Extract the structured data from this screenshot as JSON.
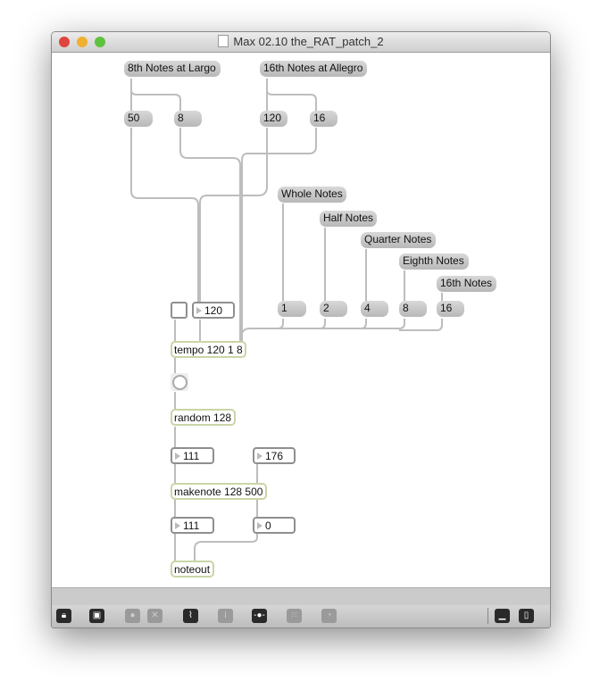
{
  "window": {
    "title": "Max 02.10 the_RAT_patch_2"
  },
  "patch": {
    "largo": "8th Notes at Largo",
    "allegro": "16th Notes at Allegro",
    "m50": "50",
    "m8a": "8",
    "m120": "120",
    "m16a": "16",
    "whole": "Whole Notes",
    "half": "Half Notes",
    "quarter": "Quarter Notes",
    "eighth": "Eighth Notes",
    "sixteenth": "16th Notes",
    "m1": "1",
    "m2": "2",
    "m4": "4",
    "m8b": "8",
    "m16b": "16",
    "tempo_num": "120",
    "tempo": "tempo 120 1 8",
    "random": "random 128",
    "pitch_num": "111",
    "dur_num": "176",
    "makenote": "makenote 128 500",
    "out_pitch": "111",
    "out_vel": "0",
    "noteout": "noteout"
  },
  "toolbar": {
    "icons": [
      "lock-icon",
      "presentation-toggle-icon",
      "objects-icon",
      "delete-icon",
      "debug-icon",
      "inspector-icon",
      "connect-icon",
      "grid-icon",
      "palette-icon",
      "bottom-panel-icon",
      "side-panel-icon"
    ]
  }
}
